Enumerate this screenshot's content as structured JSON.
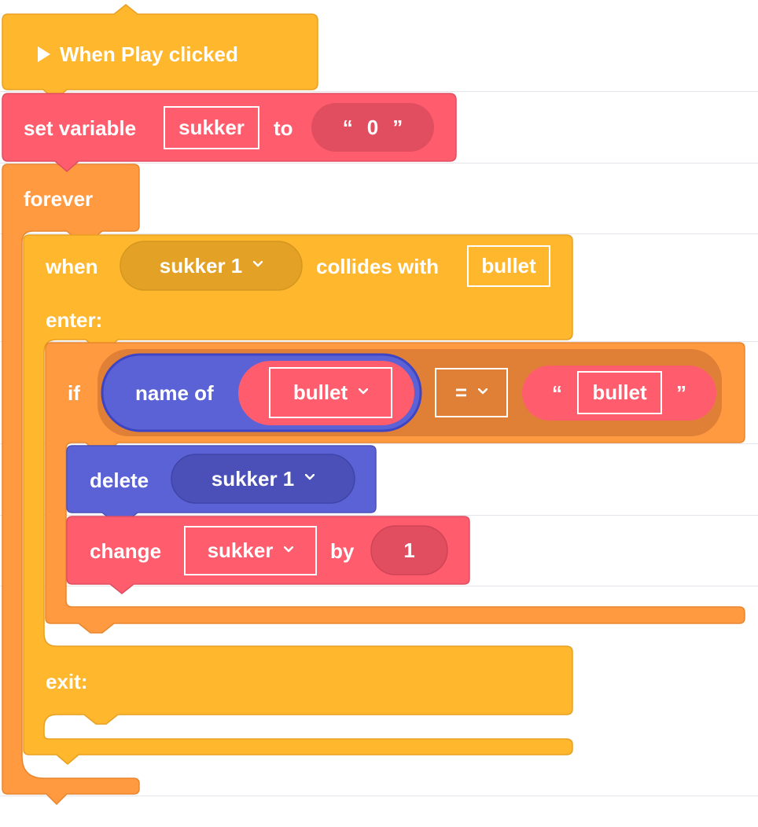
{
  "colors": {
    "event": "#FFB72E",
    "variable": "#FF5C6E",
    "variable_dark": "#E04E60",
    "control": "#FF9A40",
    "control_dark": "#E07F36",
    "object": "#5B62D6",
    "object_dark": "#4A50B8",
    "sprite_pill": "#E3A125"
  },
  "event_block": {
    "label": "When Play clicked",
    "icon": "play-icon"
  },
  "set_variable": {
    "label": "set variable",
    "variable": "sukker",
    "to_label": "to",
    "value": "0",
    "quote_open": "“",
    "quote_close": "”"
  },
  "forever": {
    "label": "forever"
  },
  "collides": {
    "when_label": "when",
    "sprite": "sukker 1",
    "collides_label": "collides with",
    "target": "bullet",
    "enter_label": "enter:",
    "exit_label": "exit:"
  },
  "if_block": {
    "label": "if",
    "name_of_label": "name of",
    "name_of_value": "bullet",
    "operator": "=",
    "compare_value": "bullet",
    "quote_open": "“",
    "quote_close": "”"
  },
  "delete_block": {
    "label": "delete",
    "sprite": "sukker 1"
  },
  "change_block": {
    "label": "change",
    "variable": "sukker",
    "by_label": "by",
    "value": "1"
  }
}
